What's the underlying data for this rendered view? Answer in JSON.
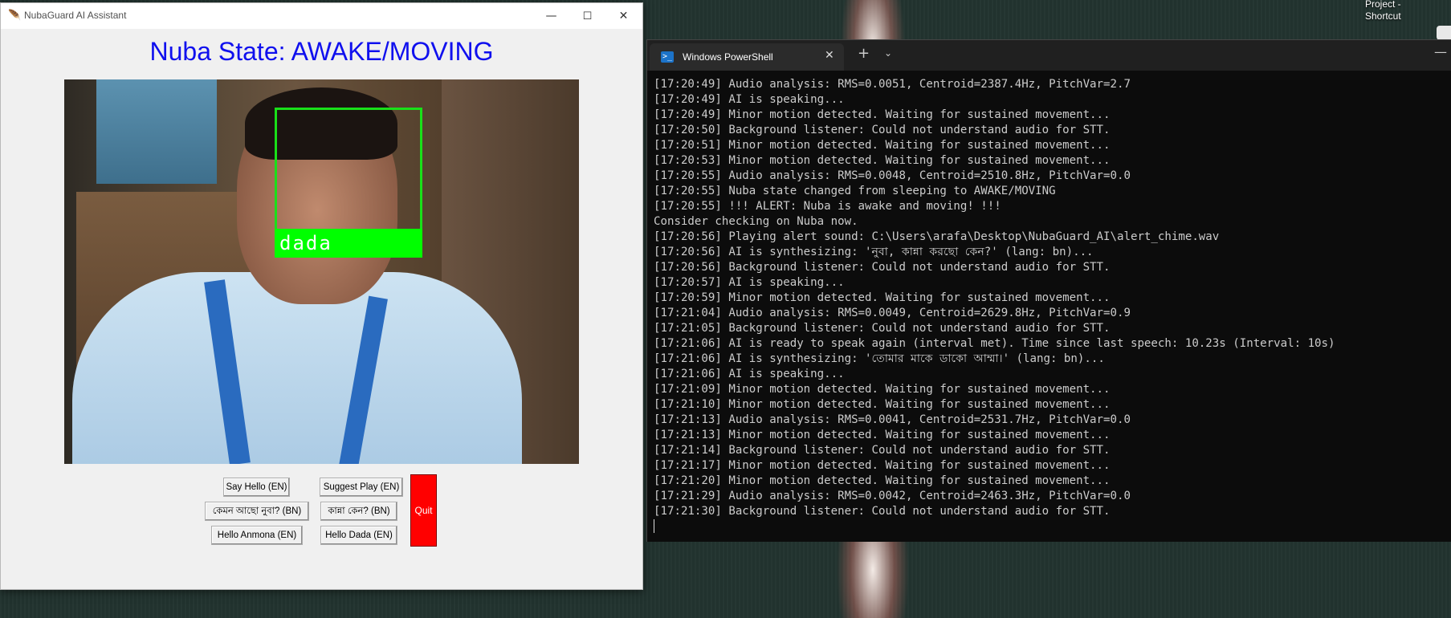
{
  "desktop": {
    "shortcut_lines": [
      "Project -",
      "Shortcut"
    ]
  },
  "tk_window": {
    "title": "NubaGuard AI Assistant",
    "minimize": "—",
    "maximize": "☐",
    "close": "✕",
    "state_text": "Nuba State: AWAKE/MOVING",
    "face_label": "dada",
    "buttons": {
      "say_hello": "Say Hello (EN)",
      "suggest_play": "Suggest Play (EN)",
      "how_are_you_bn": "কেমন আছো নুবা? (BN)",
      "why_crying_bn": "কান্না কেন? (BN)",
      "hello_anmona": "Hello Anmona (EN)",
      "hello_dada": "Hello Dada (EN)",
      "quit": "Quit"
    },
    "colors": {
      "state_text": "#1010ee",
      "face_box": "#00ff00",
      "quit_button": "#ff0000"
    }
  },
  "terminal": {
    "tab_title": "Windows PowerShell",
    "new_tab": "+",
    "dropdown": "⌄",
    "lines": [
      "[17:20:49] Audio analysis: RMS=0.0051, Centroid=2387.4Hz, PitchVar=2.7",
      "[17:20:49] AI is speaking...",
      "[17:20:49] Minor motion detected. Waiting for sustained movement...",
      "[17:20:50] Background listener: Could not understand audio for STT.",
      "[17:20:51] Minor motion detected. Waiting for sustained movement...",
      "[17:20:53] Minor motion detected. Waiting for sustained movement...",
      "[17:20:55] Audio analysis: RMS=0.0048, Centroid=2510.8Hz, PitchVar=0.0",
      "[17:20:55] Nuba state changed from sleeping to AWAKE/MOVING",
      "[17:20:55] !!! ALERT: Nuba is awake and moving! !!!",
      "Consider checking on Nuba now.",
      "[17:20:56] Playing alert sound: C:\\Users\\arafa\\Desktop\\NubaGuard_AI\\alert_chime.wav",
      "[17:20:56] AI is synthesizing: 'নুবা, কান্না করছো কেন?' (lang: bn)...",
      "[17:20:56] Background listener: Could not understand audio for STT.",
      "[17:20:57] AI is speaking...",
      "[17:20:59] Minor motion detected. Waiting for sustained movement...",
      "[17:21:04] Audio analysis: RMS=0.0049, Centroid=2629.8Hz, PitchVar=0.9",
      "[17:21:05] Background listener: Could not understand audio for STT.",
      "[17:21:06] AI is ready to speak again (interval met). Time since last speech: 10.23s (Interval: 10s)",
      "[17:21:06] AI is synthesizing: 'তোমার মাকে ডাকো আম্মা।' (lang: bn)...",
      "[17:21:06] AI is speaking...",
      "[17:21:09] Minor motion detected. Waiting for sustained movement...",
      "[17:21:10] Minor motion detected. Waiting for sustained movement...",
      "[17:21:13] Audio analysis: RMS=0.0041, Centroid=2531.7Hz, PitchVar=0.0",
      "[17:21:13] Minor motion detected. Waiting for sustained movement...",
      "[17:21:14] Background listener: Could not understand audio for STT.",
      "[17:21:17] Minor motion detected. Waiting for sustained movement...",
      "[17:21:20] Minor motion detected. Waiting for sustained movement...",
      "[17:21:29] Audio analysis: RMS=0.0042, Centroid=2463.3Hz, PitchVar=0.0",
      "[17:21:30] Background listener: Could not understand audio for STT."
    ]
  }
}
